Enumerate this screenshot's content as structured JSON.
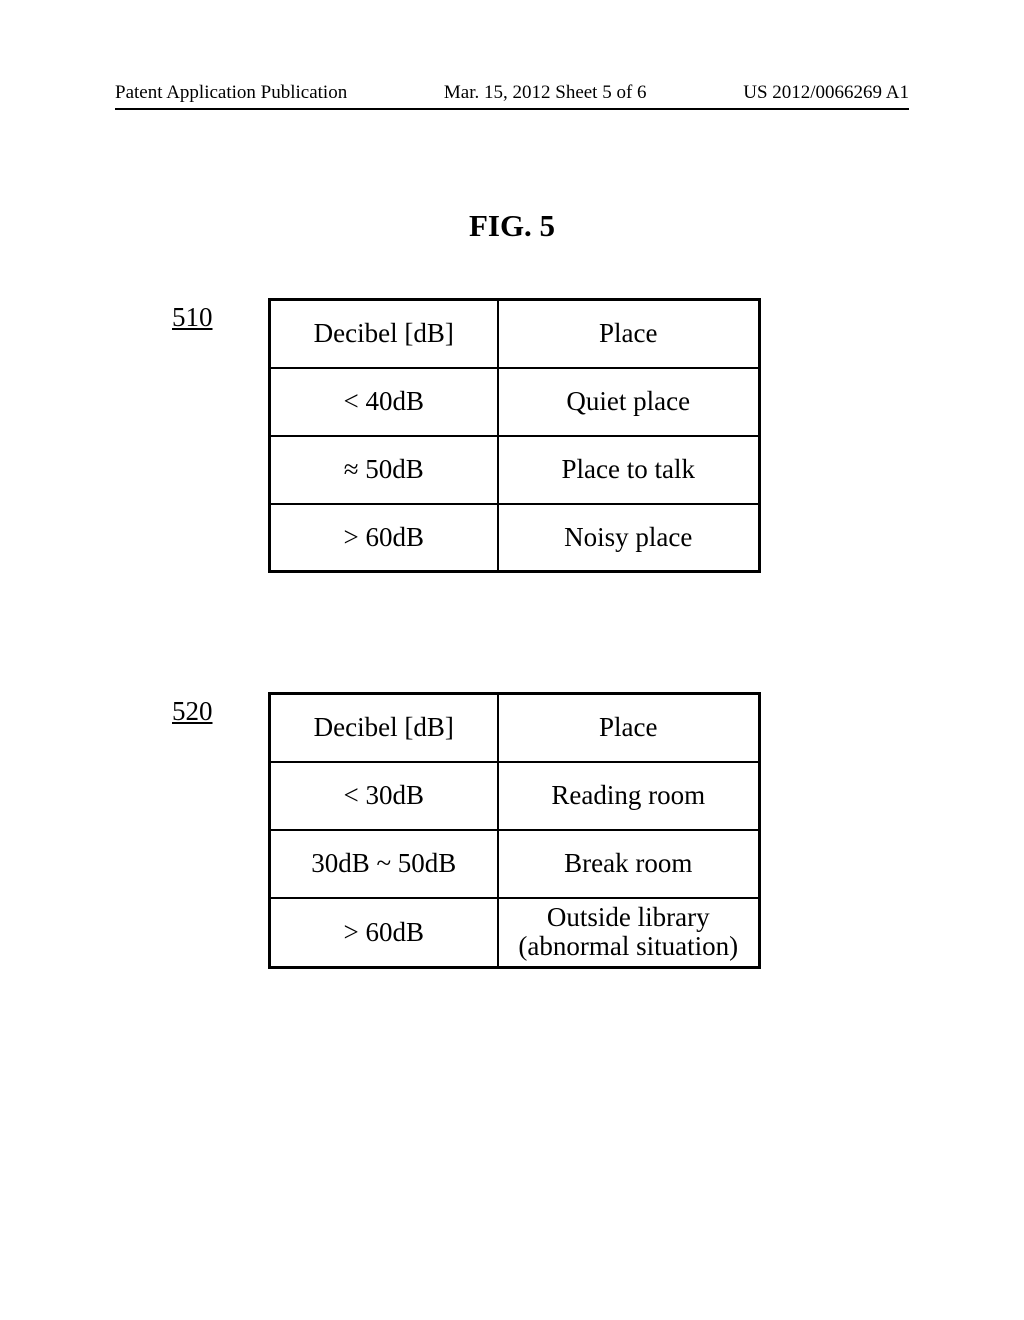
{
  "header": {
    "left": "Patent Application Publication",
    "center": "Mar. 15, 2012  Sheet 5 of 6",
    "right": "US 2012/0066269 A1"
  },
  "figure_title": "FIG. 5",
  "labels": {
    "ref510": "510",
    "ref520": "520"
  },
  "chart_data": [
    {
      "type": "table",
      "title": "510",
      "headers": [
        "Decibel [dB]",
        "Place"
      ],
      "rows": [
        {
          "decibel": "< 40dB",
          "place": "Quiet place"
        },
        {
          "decibel": "≈ 50dB",
          "place": "Place to talk"
        },
        {
          "decibel": "> 60dB",
          "place": "Noisy place"
        }
      ]
    },
    {
      "type": "table",
      "title": "520",
      "headers": [
        "Decibel [dB]",
        "Place"
      ],
      "rows": [
        {
          "decibel": "< 30dB",
          "place": "Reading room"
        },
        {
          "decibel": "30dB ~ 50dB",
          "place": "Break room"
        },
        {
          "decibel": "> 60dB",
          "place": "Outside library\n(abnormal situation)"
        }
      ]
    }
  ]
}
